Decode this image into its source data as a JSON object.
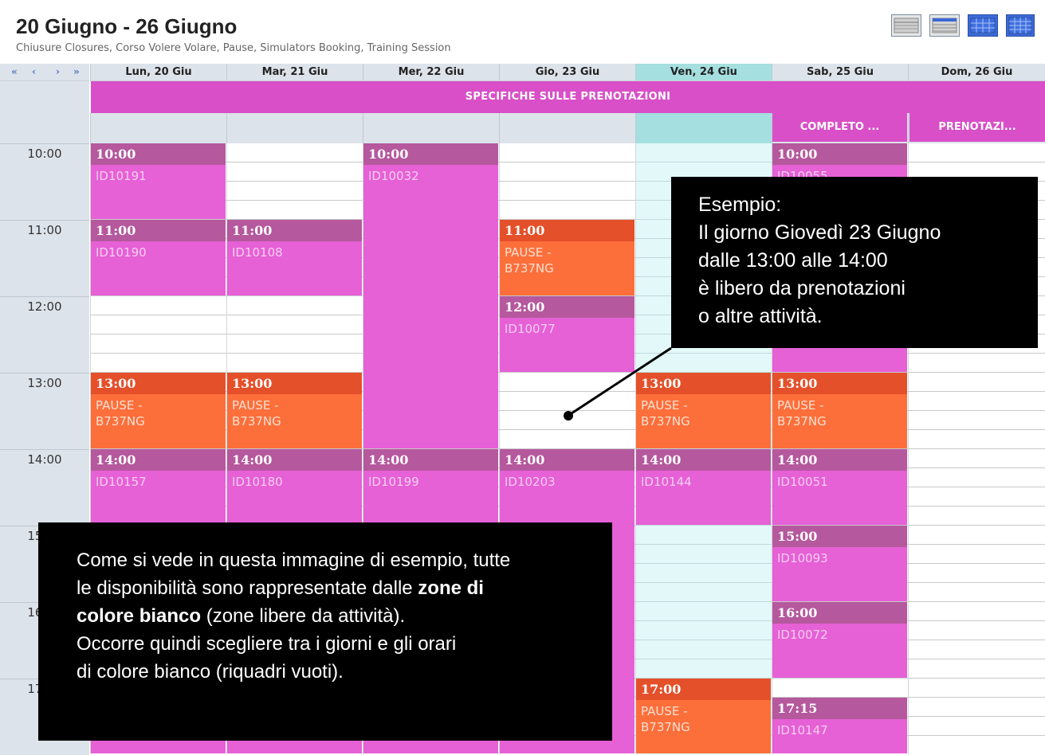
{
  "header": {
    "title": "20 Giugno - 26 Giugno",
    "subtitle": "Chiusure Closures, Corso Volere Volare, Pause, Simulators Booking, Training Session"
  },
  "view_buttons": [
    {
      "icon": "day-view-icon"
    },
    {
      "icon": "week-view-icon"
    },
    {
      "icon": "month-view-icon"
    },
    {
      "icon": "year-view-icon"
    }
  ],
  "nav": {
    "first": "«",
    "prev": "‹",
    "next": "›",
    "last": "»"
  },
  "days": [
    {
      "label": "Lun, 20 Giu"
    },
    {
      "label": "Mar, 21 Giu"
    },
    {
      "label": "Mer, 22 Giu"
    },
    {
      "label": "Gio, 23 Giu"
    },
    {
      "label": "Ven, 24 Giu",
      "today": true
    },
    {
      "label": "Sab, 25 Giu"
    },
    {
      "label": "Dom, 26 Giu"
    }
  ],
  "banner": "SPECIFICHE SULLE PRENOTAZIONI",
  "allday_events": [
    {
      "day": 5,
      "label": "COMPLETO ..."
    },
    {
      "day": 6,
      "label": "PRENOTAZI..."
    }
  ],
  "hours": [
    "10:00",
    "11:00",
    "12:00",
    "13:00",
    "14:00",
    "15:00",
    "16:00",
    "17:00"
  ],
  "events": [
    {
      "day": 0,
      "start": 10.0,
      "end": 11.0,
      "time": "10:00",
      "title": "ID10191",
      "type": "id"
    },
    {
      "day": 0,
      "start": 11.0,
      "end": 12.0,
      "time": "11:00",
      "title": "ID10190",
      "type": "id"
    },
    {
      "day": 0,
      "start": 13.0,
      "end": 14.0,
      "time": "13:00",
      "title": "PAUSE - B737NG",
      "type": "pause"
    },
    {
      "day": 0,
      "start": 14.0,
      "end": 18.0,
      "time": "14:00",
      "title": "ID10157",
      "type": "id"
    },
    {
      "day": 1,
      "start": 11.0,
      "end": 12.0,
      "time": "11:00",
      "title": "ID10108",
      "type": "id"
    },
    {
      "day": 1,
      "start": 13.0,
      "end": 14.0,
      "time": "13:00",
      "title": "PAUSE - B737NG",
      "type": "pause"
    },
    {
      "day": 1,
      "start": 14.0,
      "end": 18.0,
      "time": "14:00",
      "title": "ID10180",
      "type": "id"
    },
    {
      "day": 2,
      "start": 10.0,
      "end": 14.0,
      "time": "10:00",
      "title": "ID10032",
      "type": "id"
    },
    {
      "day": 2,
      "start": 14.0,
      "end": 18.0,
      "time": "14:00",
      "title": "ID10199",
      "type": "id"
    },
    {
      "day": 3,
      "start": 11.0,
      "end": 12.0,
      "time": "11:00",
      "title": "PAUSE - B737NG",
      "type": "pause"
    },
    {
      "day": 3,
      "start": 12.0,
      "end": 13.0,
      "time": "12:00",
      "title": "ID10077",
      "type": "id"
    },
    {
      "day": 3,
      "start": 14.0,
      "end": 18.0,
      "time": "14:00",
      "title": "ID10203",
      "type": "id"
    },
    {
      "day": 4,
      "start": 13.0,
      "end": 14.0,
      "time": "13:00",
      "title": "PAUSE - B737NG",
      "type": "pause"
    },
    {
      "day": 4,
      "start": 14.0,
      "end": 15.0,
      "time": "14:00",
      "title": "ID10144",
      "type": "id"
    },
    {
      "day": 4,
      "start": 17.0,
      "end": 18.0,
      "time": "17:00",
      "title": "PAUSE - B737NG",
      "type": "pause"
    },
    {
      "day": 5,
      "start": 10.0,
      "end": 13.0,
      "time": "10:00",
      "title": "ID10055",
      "type": "id"
    },
    {
      "day": 5,
      "start": 13.0,
      "end": 14.0,
      "time": "13:00",
      "title": "PAUSE - B737NG",
      "type": "pause"
    },
    {
      "day": 5,
      "start": 14.0,
      "end": 15.0,
      "time": "14:00",
      "title": "ID10051",
      "type": "id"
    },
    {
      "day": 5,
      "start": 15.0,
      "end": 16.0,
      "time": "15:00",
      "title": "ID10093",
      "type": "id"
    },
    {
      "day": 5,
      "start": 16.0,
      "end": 17.0,
      "time": "16:00",
      "title": "ID10072",
      "type": "id"
    },
    {
      "day": 5,
      "start": 17.25,
      "end": 18.0,
      "time": "17:15",
      "title": "ID10147",
      "type": "id"
    }
  ],
  "callout_example": {
    "lines": [
      "Esempio:",
      "Il giorno Giovedì 23 Giugno",
      "dalle 13:00 alle 14:00",
      "è libero da prenotazioni",
      "o altre attività."
    ]
  },
  "callout_info": {
    "line1": "Come si vede in questa immagine di esempio, tutte",
    "line2_pre": "le disponibilità sono rappresentate dalle ",
    "line2_bold": "zone di",
    "line3_bold": "colore bianco",
    "line3_post": " (zone libere da attività).",
    "line4": "Occorre quindi scegliere tra i giorni e gli orari",
    "line5": "di colore bianco (riquadri vuoti)."
  }
}
